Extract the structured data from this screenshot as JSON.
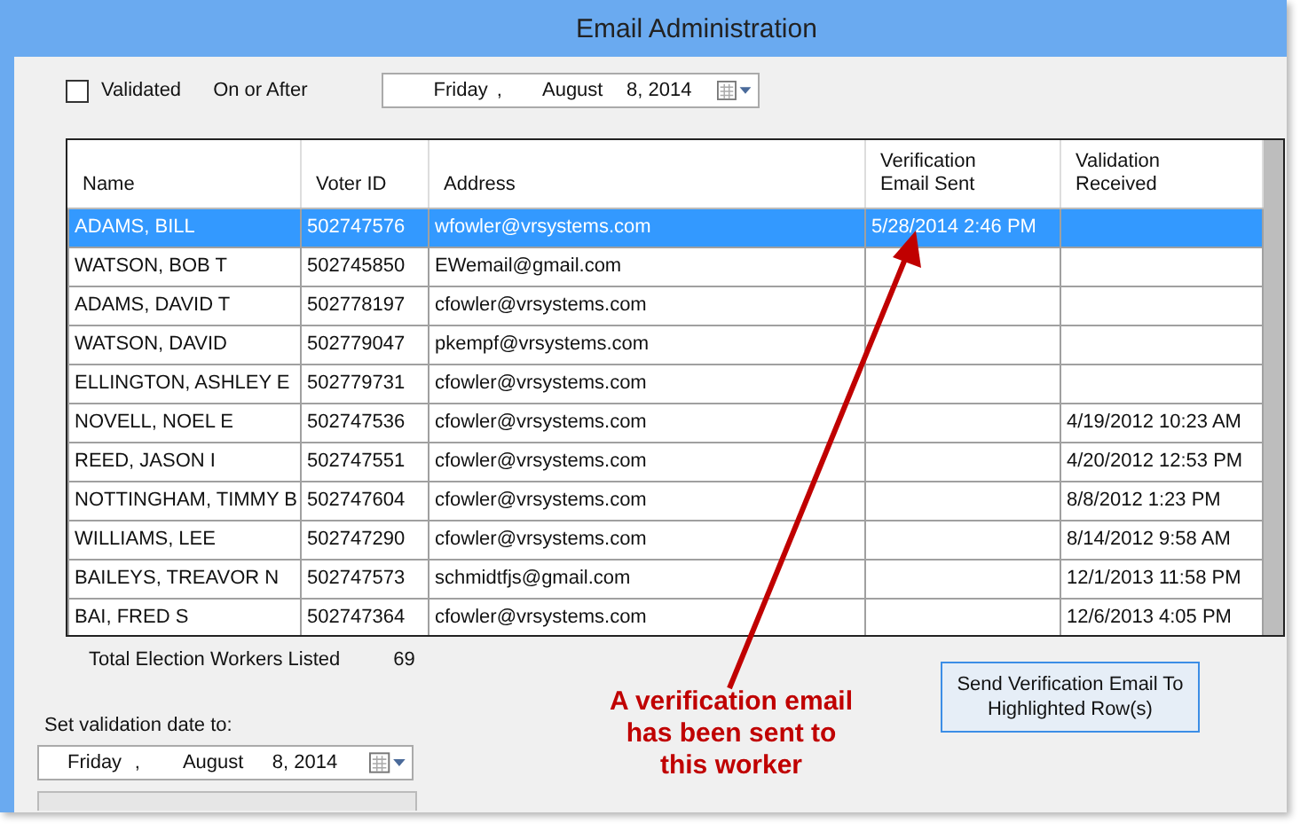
{
  "window": {
    "title": "Email Administration"
  },
  "filter": {
    "validated_label": "Validated",
    "validated_checked": false,
    "on_or_after_label": "On or After",
    "date": {
      "weekday": "Friday",
      "separator": ",",
      "month": "August",
      "day_year": "8, 2014"
    }
  },
  "table": {
    "columns": [
      "Name",
      "Voter ID",
      "Address",
      "Verification\nEmail Sent",
      "Validation\nReceived"
    ],
    "rows": [
      {
        "cells": [
          "ADAMS, BILL",
          "502747576",
          "wfowler@vrsystems.com",
          "5/28/2014 2:46 PM",
          ""
        ],
        "selected": true
      },
      {
        "cells": [
          "WATSON, BOB T",
          "502745850",
          "EWemail@gmail.com",
          "",
          ""
        ],
        "selected": false
      },
      {
        "cells": [
          "ADAMS, DAVID T",
          "502778197",
          "cfowler@vrsystems.com",
          "",
          ""
        ],
        "selected": false
      },
      {
        "cells": [
          "WATSON, DAVID",
          "502779047",
          "pkempf@vrsystems.com",
          "",
          ""
        ],
        "selected": false
      },
      {
        "cells": [
          "ELLINGTON, ASHLEY E",
          "502779731",
          "cfowler@vrsystems.com",
          "",
          ""
        ],
        "selected": false
      },
      {
        "cells": [
          "NOVELL, NOEL E",
          "502747536",
          "cfowler@vrsystems.com",
          "",
          "4/19/2012 10:23 AM"
        ],
        "selected": false
      },
      {
        "cells": [
          "REED, JASON I",
          "502747551",
          "cfowler@vrsystems.com",
          "",
          "4/20/2012 12:53 PM"
        ],
        "selected": false
      },
      {
        "cells": [
          "NOTTINGHAM, TIMMY B",
          "502747604",
          "cfowler@vrsystems.com",
          "",
          "8/8/2012 1:23 PM"
        ],
        "selected": false
      },
      {
        "cells": [
          "WILLIAMS, LEE",
          "502747290",
          "cfowler@vrsystems.com",
          "",
          "8/14/2012 9:58 AM"
        ],
        "selected": false
      },
      {
        "cells": [
          "BAILEYS, TREAVOR N",
          "502747573",
          "schmidtfjs@gmail.com",
          "",
          "12/1/2013 11:58 PM"
        ],
        "selected": false
      },
      {
        "cells": [
          "BAI, FRED S",
          "502747364",
          "cfowler@vrsystems.com",
          "",
          "12/6/2013 4:05 PM"
        ],
        "selected": false
      }
    ]
  },
  "total": {
    "label": "Total Election Workers Listed",
    "count": "69"
  },
  "send_button": "Send Verification Email To\nHighlighted Row(s)",
  "set_date": {
    "label": "Set validation date to:",
    "date": {
      "weekday": "Friday",
      "separator": ",",
      "month": "August",
      "day_year": "8, 2014"
    }
  },
  "annotation": "A verification email\nhas been sent to\nthis worker"
}
